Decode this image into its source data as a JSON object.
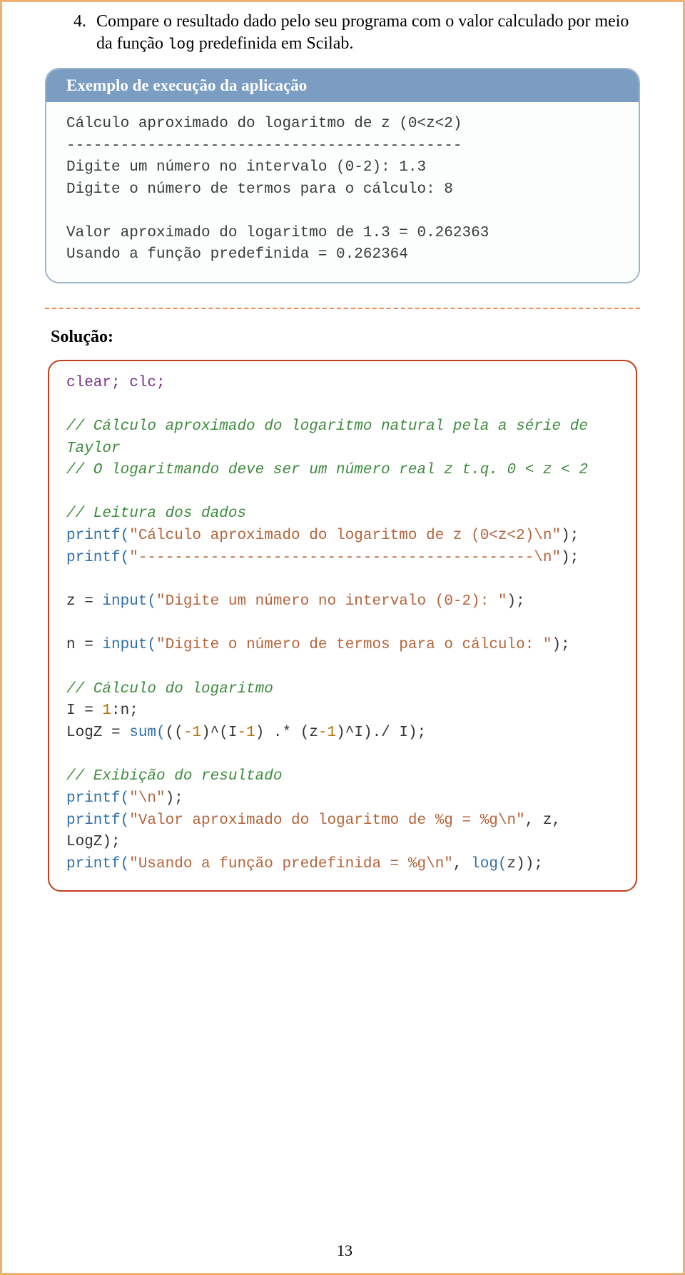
{
  "item": {
    "number": "4.",
    "text_before": "Compare o resultado dado pelo seu programa com o valor calculado por meio da função ",
    "code_inline": "log",
    "text_after": " predefinida em Scilab."
  },
  "box1": {
    "header": "Exemplo de execução da aplicação",
    "body": "Cálculo aproximado do logaritmo de z (0<z<2)\n--------------------------------------------\nDigite um número no intervalo (0-2): 1.3\nDigite o número de termos para o cálculo: 8\n\nValor aproximado do logaritmo de 1.3 = 0.262363\nUsando a função predefinida = 0.262364"
  },
  "solution_label": "Solução:",
  "code": {
    "l01": "clear; clc;",
    "l03": "// Cálculo aproximado do logaritmo natural pela a série de Taylor",
    "l04": "// O logaritmando deve ser um número real z t.q. 0 < z < 2",
    "l06": "// Leitura dos dados",
    "l07_fn": "printf(",
    "l07_str": "\"Cálculo aproximado do logaritmo de z (0<z<2)\\n\"",
    "l07_end": ");",
    "l08_fn": "printf(",
    "l08_str": "\"--------------------------------------------\\n\"",
    "l08_end": ");",
    "l10_lhs": "z = ",
    "l10_fn": "input(",
    "l10_str": "\"Digite um número no intervalo (0-2): \"",
    "l10_end": ");",
    "l12_lhs": "n = ",
    "l12_fn": "input(",
    "l12_str": "\"Digite o número de termos para o cálculo: \"",
    "l12_end": ");",
    "l14": "// Cálculo do logaritmo",
    "l15_a": "I = ",
    "l15_n1": "1",
    "l15_b": ":n;",
    "l16_a": "LogZ = ",
    "l16_fn": "sum(",
    "l16_b": "((",
    "l16_nm1": "-1",
    "l16_c": ")^(I",
    "l16_nm1b": "-1",
    "l16_d": ") .* (z",
    "l16_nm1c": "-1",
    "l16_e": ")^I)./ I);",
    "l18": "// Exibição do resultado",
    "l19_fn": "printf(",
    "l19_str": "\"\\n\"",
    "l19_end": ");",
    "l20_fn": "printf(",
    "l20_str": "\"Valor aproximado do logaritmo de %g = %g\\n\"",
    "l20_rest": ", z, LogZ);",
    "l21_fn": "printf(",
    "l21_str": "\"Usando a função predefinida = %g\\n\"",
    "l21_rest": ", ",
    "l21_fn2": "log(",
    "l21_rest2": "z));"
  },
  "page_number": "13"
}
